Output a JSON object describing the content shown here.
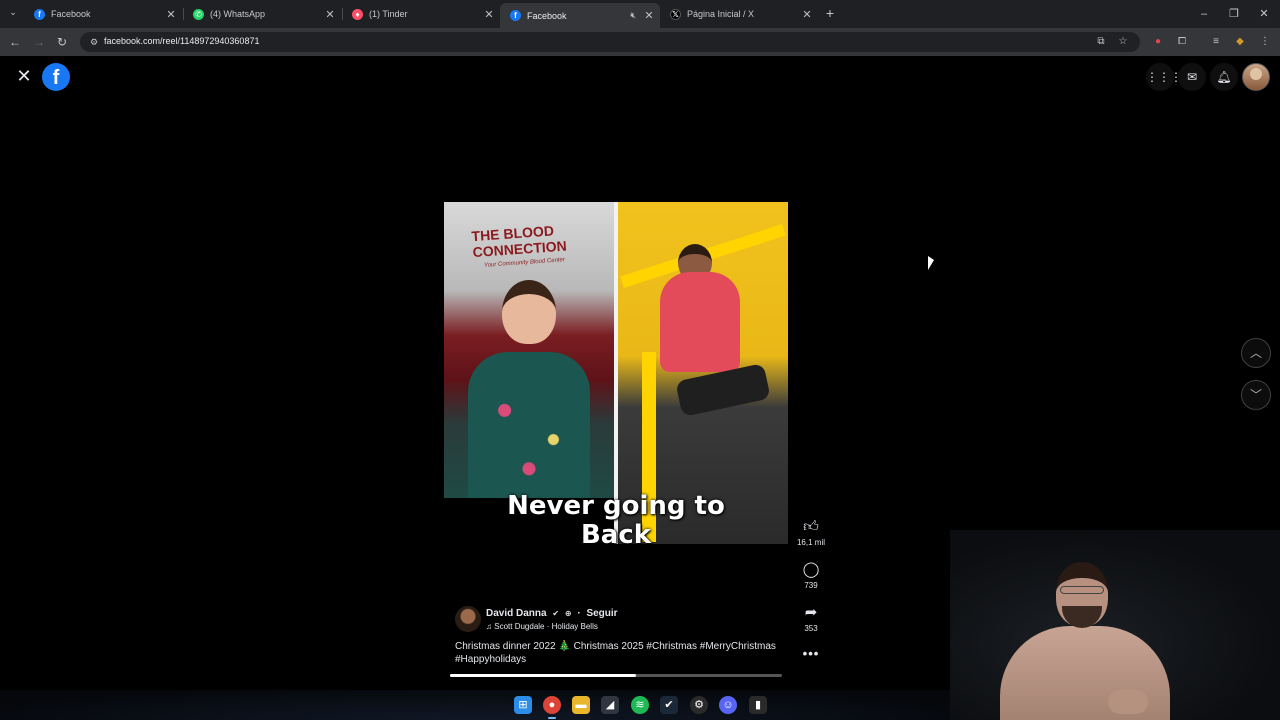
{
  "browser": {
    "tabs": [
      {
        "title": "Facebook",
        "favicon": "facebook-icon",
        "color": "#1877f2",
        "active": false,
        "audio": false
      },
      {
        "title": "(4) WhatsApp",
        "favicon": "whatsapp-icon",
        "color": "#25d366",
        "active": false,
        "audio": false
      },
      {
        "title": "(1) Tinder",
        "favicon": "tinder-icon",
        "color": "#fd5068",
        "active": false,
        "audio": false
      },
      {
        "title": "Facebook",
        "favicon": "facebook-icon",
        "color": "#1877f2",
        "active": true,
        "audio": true
      },
      {
        "title": "Página Inicial / X",
        "favicon": "x-icon",
        "color": "#000000",
        "active": false,
        "audio": false
      }
    ],
    "url": "facebook.com/reel/1148972940360871"
  },
  "reel": {
    "video_text": {
      "banner": "THE BLOOD CONNECTION",
      "banner_sub": "Your Community Blood Center"
    },
    "caption_overlay_line1": "Never going to",
    "caption_overlay_line2": "Back",
    "likes": "16,1 mil",
    "comments": "739",
    "shares": "353",
    "author": "David Danna",
    "follow": "Seguir",
    "music": "Scott Dugdale · Holiday Bells",
    "description": "Christmas dinner 2022 🎄 Christmas 2025 #Christmas #MerryChristmas #Happyholidays",
    "progress": 0.56
  },
  "colors": {
    "facebook_blue": "#1877f2",
    "page_bg": "#000000",
    "tab_bar": "#1f2023",
    "toolbar": "#35363a"
  }
}
